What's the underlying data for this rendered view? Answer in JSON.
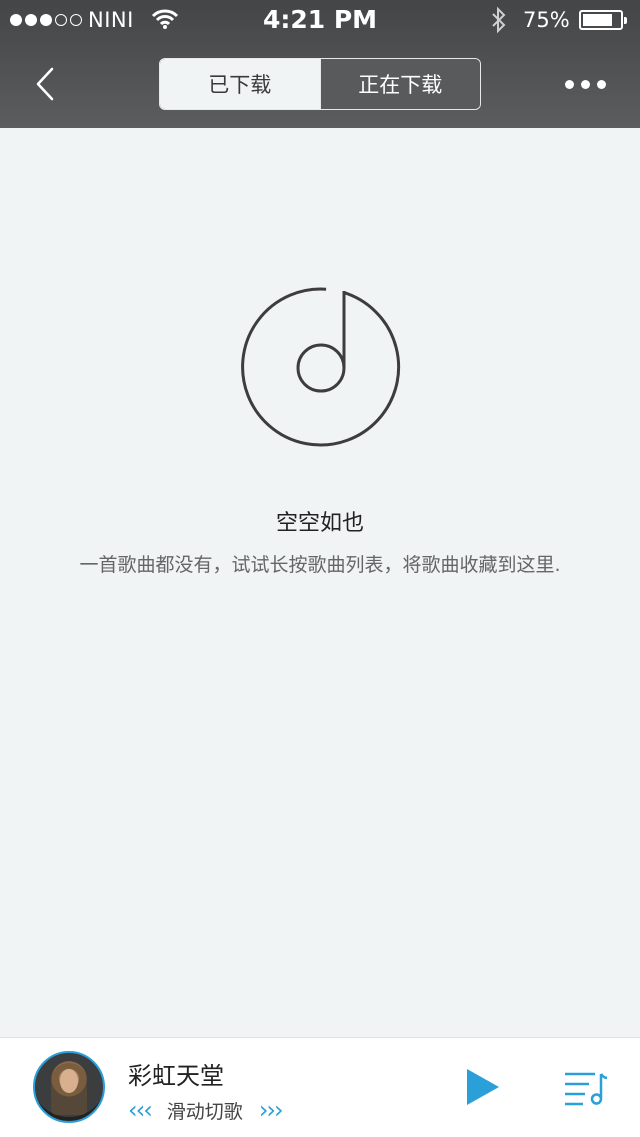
{
  "status_bar": {
    "carrier": "NINI",
    "time": "4:21 PM",
    "battery_percent": "75%",
    "battery_level": 0.75,
    "signal_strength": 3,
    "signal_max": 5
  },
  "nav": {
    "tabs": [
      {
        "label": "已下载",
        "active": true
      },
      {
        "label": "正在下载",
        "active": false
      }
    ]
  },
  "empty_state": {
    "icon": "music-note-disc-icon",
    "title": "空空如也",
    "description": "一首歌曲都没有，试试长按歌曲列表，将歌曲收藏到这里."
  },
  "player": {
    "song_title": "彩虹天堂",
    "swipe_hint": "滑动切歌",
    "accent_color": "#2a9fd8"
  }
}
